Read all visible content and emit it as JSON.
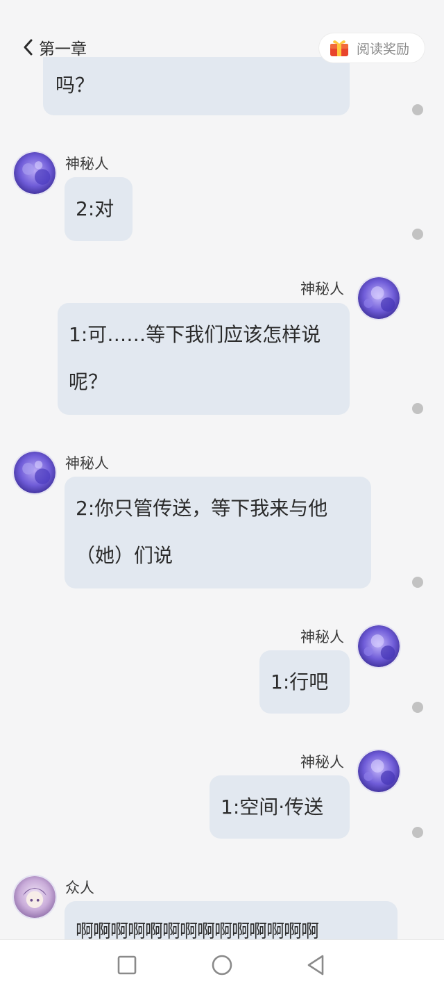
{
  "header": {
    "back_label": "第一章",
    "reward_label": "阅读奖励"
  },
  "messages": [
    {
      "side": "right",
      "name": "",
      "lines": [
        "吗？"
      ]
    },
    {
      "side": "left",
      "name": "神秘人",
      "lines": [
        "2:对"
      ]
    },
    {
      "side": "right",
      "name": "神秘人",
      "lines": [
        "1:可……等下我们应该怎样说",
        "呢？"
      ]
    },
    {
      "side": "left",
      "name": "神秘人",
      "lines": [
        "2:你只管传送，等下我来与他",
        "（她）们说"
      ]
    },
    {
      "side": "right",
      "name": "神秘人",
      "lines": [
        "1:行吧"
      ]
    },
    {
      "side": "right",
      "name": "神秘人",
      "lines": [
        "1:空间·传送"
      ]
    },
    {
      "side": "left",
      "name": "众人",
      "lines": [
        "啊啊啊啊啊啊啊啊啊啊啊啊啊啊"
      ]
    }
  ],
  "colors": {
    "background": "#f5f5f6",
    "bubble": "#e2e8f0",
    "avatar_theme": "#6b5bd6",
    "reward_icon": "#e8452c"
  },
  "navbar": {
    "icons": [
      "recent-apps-icon",
      "home-icon",
      "back-icon"
    ]
  }
}
